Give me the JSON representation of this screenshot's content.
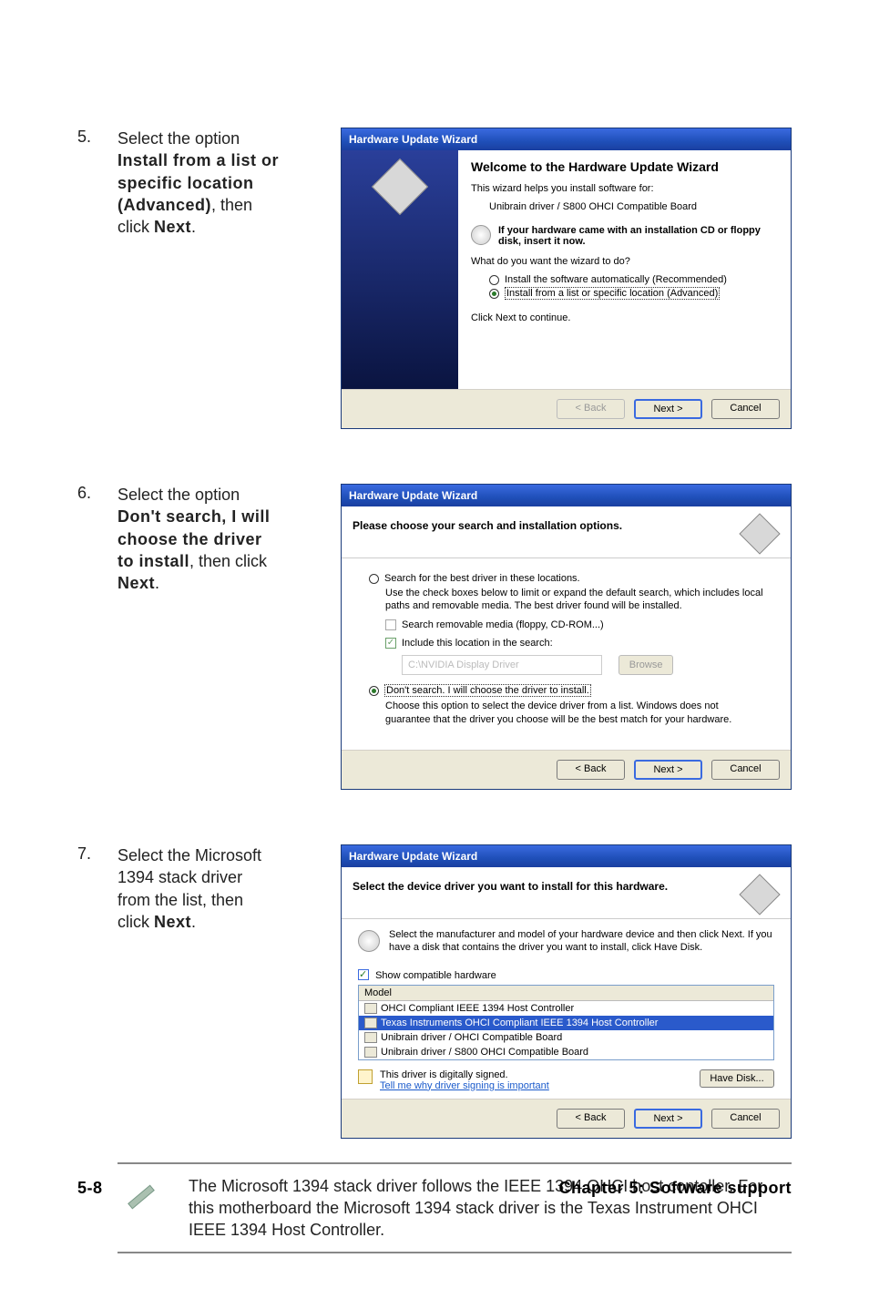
{
  "steps": {
    "s5": {
      "num": "5.",
      "text_a": "Select the option ",
      "bold": "Install from a list or specific location (Advanced)",
      "text_b": ", then click ",
      "next": "Next",
      "text_c": "."
    },
    "s6": {
      "num": "6.",
      "text_a": "Select the option ",
      "bold": "Don't search, I will choose the driver to install",
      "text_b": ", then click ",
      "next": "Next",
      "text_c": "."
    },
    "s7": {
      "num": "7.",
      "text": "Select the Microsoft 1394 stack driver from the list, then click ",
      "next": "Next",
      "text_c": "."
    }
  },
  "dialog5": {
    "title": "Hardware Update Wizard",
    "heading": "Welcome to the Hardware Update Wizard",
    "intro": "This wizard helps you install software for:",
    "device": "Unibrain driver / S800 OHCI Compatible Board",
    "cd_note": "If your hardware came with an installation CD or floppy disk, insert it now.",
    "question": "What do you want the wizard to do?",
    "opt_auto": "Install the software automatically (Recommended)",
    "opt_adv": "Install from a list or specific location (Advanced)",
    "continue": "Click Next to continue.",
    "back": "< Back",
    "next": "Next >",
    "cancel": "Cancel"
  },
  "dialog6": {
    "title": "Hardware Update Wizard",
    "heading": "Please choose your search and installation options.",
    "opt_search": "Search for the best driver in these locations.",
    "search_desc": "Use the check boxes below to limit or expand the default search, which includes local paths and removable media. The best driver found will be installed.",
    "chk_media": "Search removable media (floppy, CD-ROM...)",
    "chk_loc": "Include this location in the search:",
    "path": "C:\\NVIDIA Display Driver",
    "browse": "Browse",
    "opt_dont": "Don't search. I will choose the driver to install.",
    "dont_desc": "Choose this option to select the device driver from a list.  Windows does not guarantee that the driver you choose will be the best match for your hardware.",
    "back": "< Back",
    "next": "Next >",
    "cancel": "Cancel"
  },
  "dialog7": {
    "title": "Hardware Update Wizard",
    "heading": "Select the device driver you want to install for this hardware.",
    "instr": "Select the manufacturer and model of your hardware device and then click Next. If you have a disk that contains the driver you want to install, click Have Disk.",
    "show_compat": "Show compatible hardware",
    "col_model": "Model",
    "rows": [
      "OHCI Compliant IEEE 1394 Host Controller",
      "Texas Instruments OHCI Compliant IEEE 1394 Host Controller",
      "Unibrain driver / OHCI Compatible Board",
      "Unibrain driver / S800 OHCI Compatible Board"
    ],
    "signed": "This driver is digitally signed.",
    "signed_link": "Tell me why driver signing is important",
    "have_disk": "Have Disk...",
    "back": "< Back",
    "next": "Next >",
    "cancel": "Cancel"
  },
  "note": "The Microsoft 1394 stack driver follows the IEEE 1394 OHCI host contoller. For this motherboard the Microsoft 1394 stack driver is the Texas Instrument OHCI IEEE 1394 Host Controller.",
  "footer": {
    "left": "5-8",
    "right": "Chapter 5: Software support"
  }
}
